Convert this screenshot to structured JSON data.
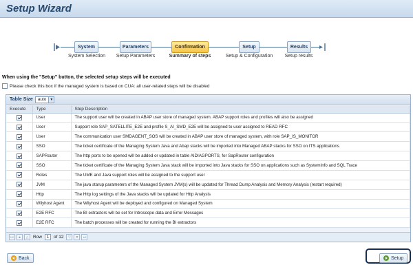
{
  "header": {
    "title": "Setup Wizard"
  },
  "roadmap": {
    "steps": [
      {
        "label": "System",
        "sub": "System Selection",
        "active": false
      },
      {
        "label": "Parameters",
        "sub": "Setup Parameters",
        "active": false
      },
      {
        "label": "Confirmation",
        "sub": "Summary of steps",
        "active": true
      },
      {
        "label": "Setup",
        "sub": "Setup & Configuration",
        "active": false
      },
      {
        "label": "Results",
        "sub": "Setup results",
        "active": false
      }
    ]
  },
  "info_text": "When using the \"Setup\" button, the selected setup steps will be executed",
  "cua_checkbox_label": "Please check this box if the managed system is based on CUA: all user-related steps will be disabled",
  "table": {
    "size_label": "Table Size",
    "size_value": "auto",
    "columns": [
      "Execute",
      "Type",
      "Step Description"
    ],
    "rows": [
      {
        "type": "User",
        "desc": "The support user will be created in ABAP user store of managed system. ABAP support roles and profiles will also be assigned"
      },
      {
        "type": "User",
        "desc": "Support role SAP_SATELLITE_E2E and profile S_AI_SMD_E2E will be assigned to user assigned to READ RFC"
      },
      {
        "type": "User",
        "desc": "The communication user SMDAGENT_SOS will be created in ABAP user store of managed system, with role SAP_IS_MONITOR"
      },
      {
        "type": "SSO",
        "desc": "The ticket certificate of the Managing System Java and Abap stacks will be imported into Managed ABAP stacks for SSO on ITS applications"
      },
      {
        "type": "SAPRouter",
        "desc": "The http ports to be opened will be added or updated in table AIDIAGPORTS, for SapRouter configuration"
      },
      {
        "type": "SSO",
        "desc": "The ticket certificate of the Managing System Java stack will be imported into Java stacks for SSO on applications such as SystemInfo and SQL Trace"
      },
      {
        "type": "Roles",
        "desc": "The UME and Java support roles will be assigned to the support user"
      },
      {
        "type": "JVM",
        "desc": "The java starup parameters of the Managed System JVM(s) will be updated for Thread Dump Analysis and Memory Analysis (restart required)"
      },
      {
        "type": "Http",
        "desc": "The Http log settings of the Java stacks will be updated for Http Analysis"
      },
      {
        "type": "Wilyhost Agent",
        "desc": "The Wilyhost Agent will be deployed and configured on Managed System"
      },
      {
        "type": "E2E RFC",
        "desc": "The BI extractors will be set for Introscope data and Error Messages"
      },
      {
        "type": "E2E RFC",
        "desc": "The batch processes will be created for running the BI extractors"
      }
    ],
    "pager": {
      "row_label": "Row",
      "row_value": "1",
      "of_label": "of 12"
    }
  },
  "buttons": {
    "back": "Back",
    "setup": "Setup"
  },
  "colors": {
    "active_step": "#f6c646",
    "header_text": "#25496f",
    "run_icon": "#5a9b2f",
    "back_icon": "#e9a21a"
  }
}
